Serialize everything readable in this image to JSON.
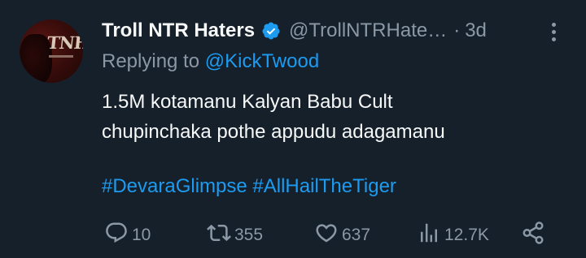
{
  "tweet": {
    "avatar_logo": "TNH",
    "display_name": "Troll NTR Haters",
    "handle": "@TrollNTRHate…",
    "separator": "·",
    "time": "3d",
    "replying_prefix": "Replying to",
    "replying_mention": "@KickTwood",
    "text_lines": [
      "1.5M kotamanu Kalyan Babu Cult",
      "chupinchaka pothe appudu adagamanu"
    ],
    "hashtags": [
      "#DevaraGlimpse",
      "#AllHailTheTiger"
    ]
  },
  "actions": {
    "replies": "10",
    "retweets": "355",
    "likes": "637",
    "views": "12.7K"
  },
  "colors": {
    "background": "#15202b",
    "link": "#1d9bf0",
    "secondary_text": "#8b98a5",
    "primary_text": "#f7f9f9"
  }
}
